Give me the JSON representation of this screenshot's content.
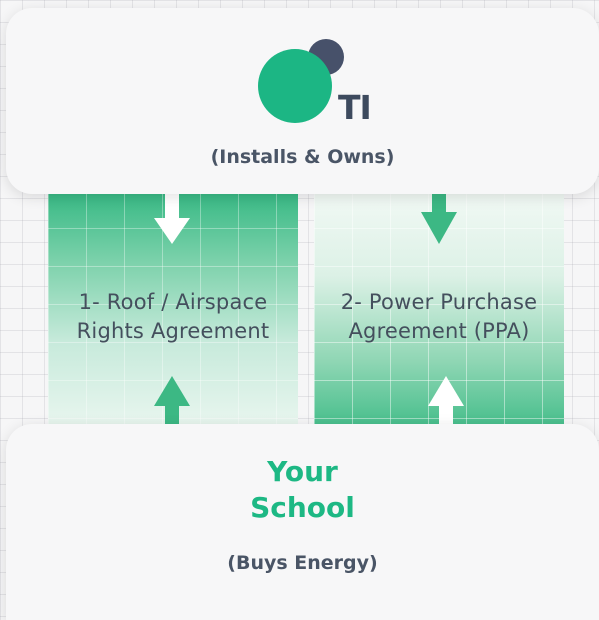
{
  "top_card": {
    "logo_text": "TI",
    "subtitle": "(Installs & Owns)"
  },
  "columns": [
    {
      "line1": "1- Roof / Airspace",
      "line2": "Rights Agreement"
    },
    {
      "line1": "2- Power Purchase",
      "line2": "Agreement (PPA)"
    }
  ],
  "bottom_card": {
    "title_line1": "Your",
    "title_line2": "School",
    "subtitle": "(Buys Energy)"
  },
  "colors": {
    "brand_green": "#1db884",
    "logo_dark": "#3d4a5e",
    "text_gray": "#444f5d"
  }
}
